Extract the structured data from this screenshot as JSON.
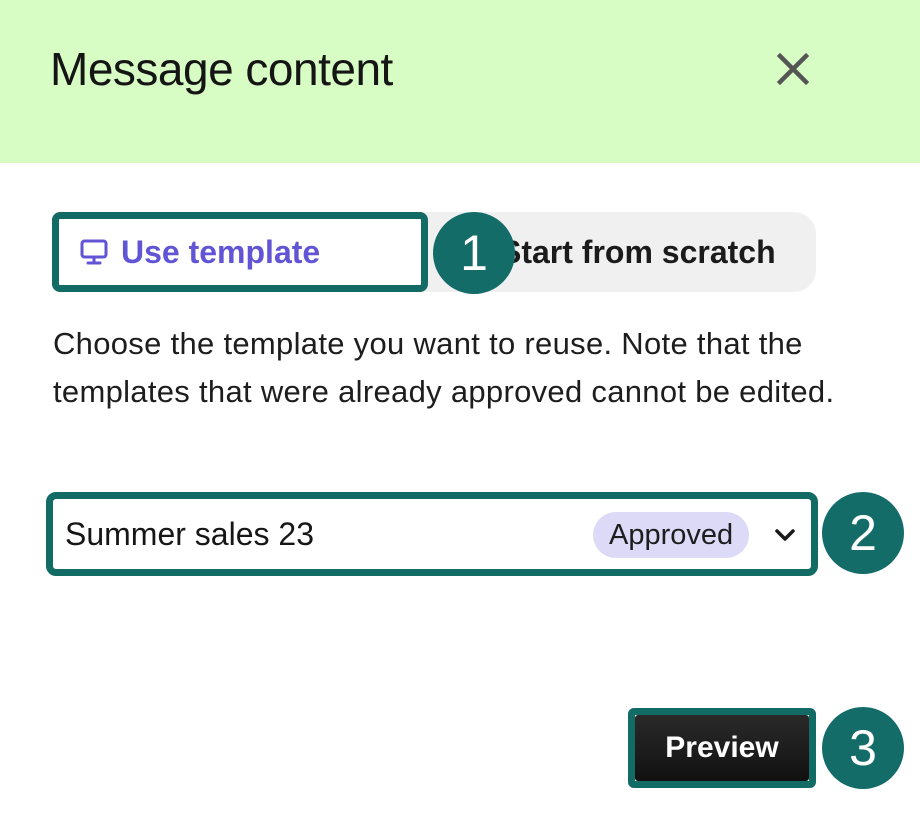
{
  "header": {
    "title": "Message content",
    "close_icon": "close-icon",
    "background_color": "#d7fcc4"
  },
  "source_toggle": {
    "options": [
      {
        "label": "Use template",
        "icon": "monitor-icon",
        "selected": true
      },
      {
        "label": "Start from scratch",
        "selected": false
      }
    ],
    "accent_color": "#6155d6"
  },
  "description": "Choose the template you want to reuse. Note that the templates that were already approved cannot be edited.",
  "template_select": {
    "value": "Summer sales 23",
    "badge": "Approved",
    "icon": "chevron-down-icon"
  },
  "actions": {
    "preview_label": "Preview"
  },
  "markers": [
    "1",
    "2",
    "3"
  ],
  "highlight_color": "#136b66"
}
